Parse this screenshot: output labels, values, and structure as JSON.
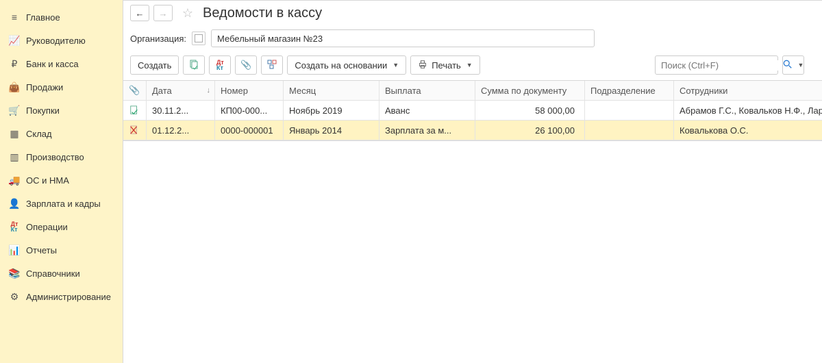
{
  "sidebar": {
    "items": [
      {
        "label": "Главное",
        "icon": "menu"
      },
      {
        "label": "Руководителю",
        "icon": "trend"
      },
      {
        "label": "Банк и касса",
        "icon": "ruble"
      },
      {
        "label": "Продажи",
        "icon": "bag"
      },
      {
        "label": "Покупки",
        "icon": "cart"
      },
      {
        "label": "Склад",
        "icon": "boxes"
      },
      {
        "label": "Производство",
        "icon": "bars"
      },
      {
        "label": "ОС и НМА",
        "icon": "truck"
      },
      {
        "label": "Зарплата и кадры",
        "icon": "person"
      },
      {
        "label": "Операции",
        "icon": "dtkt"
      },
      {
        "label": "Отчеты",
        "icon": "chart"
      },
      {
        "label": "Справочники",
        "icon": "books"
      },
      {
        "label": "Администрирование",
        "icon": "gear"
      }
    ]
  },
  "header": {
    "title": "Ведомости в кассу"
  },
  "org": {
    "label": "Организация:",
    "value": "Мебельный магазин №23"
  },
  "toolbar": {
    "create": "Создать",
    "create_based": "Создать на основании",
    "print": "Печать"
  },
  "search": {
    "placeholder": "Поиск (Ctrl+F)"
  },
  "columns": {
    "date": "Дата",
    "number": "Номер",
    "month": "Месяц",
    "payment": "Выплата",
    "sum": "Сумма по документу",
    "dept": "Подразделение",
    "employees": "Сотрудники"
  },
  "rows": [
    {
      "selected": false,
      "icon": "ok",
      "date": "30.11.2...",
      "number": "КП00-000...",
      "month": "Ноябрь 2019",
      "payment": "Аванс",
      "sum": "58 000,00",
      "dept": "",
      "employees": "Абрамов Г.С., Ковальков Н.Ф., Ларион"
    },
    {
      "selected": true,
      "icon": "marked",
      "date": "01.12.2...",
      "number": "0000-000001",
      "month": "Январь 2014",
      "payment": "Зарплата за м...",
      "sum": "26 100,00",
      "dept": "",
      "employees": "Ковалькова О.С."
    }
  ]
}
